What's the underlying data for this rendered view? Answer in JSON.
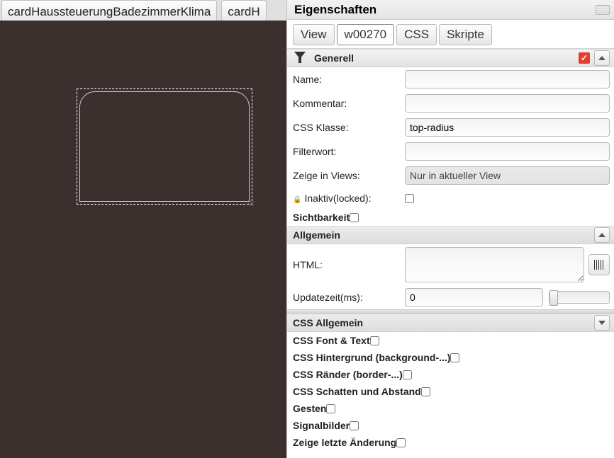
{
  "canvas": {
    "tabs": [
      "cardHaussteuerungBadezimmerKlima",
      "cardH"
    ]
  },
  "panel": {
    "title": "Eigenschaften"
  },
  "tabs": {
    "view": "View",
    "widget": "w00270",
    "css": "CSS",
    "skripte": "Skripte"
  },
  "sections": {
    "generell": "Generell",
    "sichtbarkeit": "Sichtbarkeit",
    "allgemein": "Allgemein",
    "css_allgemein": "CSS Allgemein",
    "css_font": "CSS Font & Text",
    "css_bg": "CSS Hintergrund (background-...)",
    "css_border": "CSS Ränder (border-...)",
    "css_shadow": "CSS Schatten und Abstand",
    "gesten": "Gesten",
    "signalbilder": "Signalbilder",
    "last_change": "Zeige letzte Änderung"
  },
  "form": {
    "name_label": "Name:",
    "name_value": "",
    "kommentar_label": "Kommentar:",
    "kommentar_value": "",
    "css_klasse_label": "CSS Klasse:",
    "css_klasse_value": "top-radius",
    "filterwort_label": "Filterwort:",
    "filterwort_value": "",
    "zeige_views_label": "Zeige in Views:",
    "zeige_views_value": "Nur in aktueller View",
    "inaktiv_label": "Inaktiv(locked):",
    "html_label": "HTML:",
    "html_value": "",
    "updatezeit_label": "Updatezeit(ms):",
    "updatezeit_value": "0"
  }
}
